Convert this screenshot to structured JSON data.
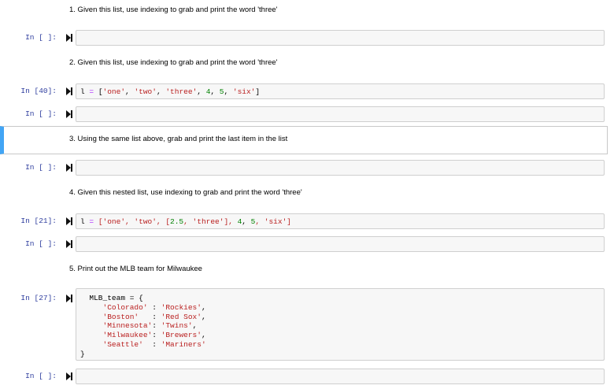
{
  "cells": {
    "q1": {
      "text": "1. Given this list, use indexing to grab and print the word 'three'"
    },
    "c1": {
      "prompt": "In [ ]:"
    },
    "q2": {
      "text": "2. Given this list, use indexing to grab and print the word 'three'"
    },
    "c2": {
      "prompt": "In [40]:",
      "code": {
        "var": "l",
        "eq": "=",
        "open": "[",
        "s1": "'one'",
        "comma1": ", ",
        "s2": "'two'",
        "comma2": ", ",
        "s3": "'three'",
        "comma3": ", ",
        "n1": "4",
        "comma4": ", ",
        "n2": "5",
        "comma5": ", ",
        "s4": "'six'",
        "close": "]"
      }
    },
    "c3": {
      "prompt": "In [ ]:"
    },
    "q3": {
      "text": "3. Using the same list above, grab and print the last item in the list"
    },
    "c4": {
      "prompt": "In [ ]:"
    },
    "q4": {
      "text": "4. Given this nested list, use indexing to grab and print the word 'three'"
    },
    "c5": {
      "prompt": "In [21]:",
      "code": {
        "var": "l",
        "eq": "=",
        "open": "['one', 'two', [",
        "n0": "2.5",
        "mid": ", 'three'], ",
        "n1": "4",
        "comma": ", ",
        "n2": "5",
        "end": ", 'six']"
      }
    },
    "c6": {
      "prompt": "In [ ]:"
    },
    "q5": {
      "text": "5. Print out the MLB team for Milwaukee"
    },
    "c7": {
      "prompt": "In [27]:",
      "head": "MLB_team = {",
      "rows": [
        {
          "key": "'Colorado'",
          "sep": " : ",
          "val": "'Rockies'",
          "tail": ","
        },
        {
          "key": "'Boston'",
          "sep": "   : ",
          "val": "'Red Sox'",
          "tail": ","
        },
        {
          "key": "'Minnesota'",
          "sep": ": ",
          "val": "'Twins'",
          "tail": ","
        },
        {
          "key": "'Milwaukee'",
          "sep": ": ",
          "val": "'Brewers'",
          "tail": ","
        },
        {
          "key": "'Seattle'",
          "sep": "  : ",
          "val": "'Mariners'",
          "tail": ""
        }
      ],
      "close": "}"
    },
    "c8": {
      "prompt": "In [ ]:"
    }
  },
  "icons": {
    "run": "run-cell-icon"
  },
  "colors": {
    "prompt": "#303f9f",
    "string": "#ba2121",
    "number": "#008000",
    "selected": "#42a5f5"
  }
}
